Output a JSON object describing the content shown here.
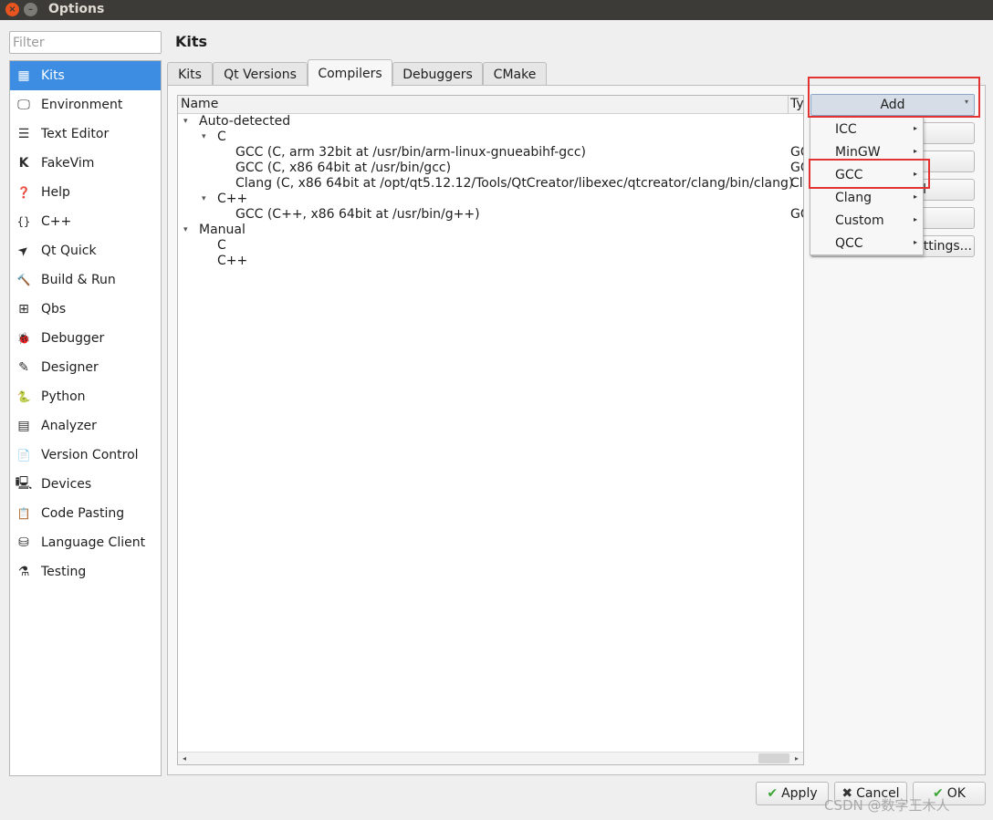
{
  "window": {
    "title": "Options",
    "close_glyph": "×",
    "min_glyph": "–"
  },
  "filter": {
    "placeholder": "Filter",
    "value": ""
  },
  "sidebar": {
    "items": [
      {
        "label": "Kits",
        "icon": "kits-icon",
        "glyph": "▦"
      },
      {
        "label": "Environment",
        "icon": "monitor-icon",
        "glyph": "🖵"
      },
      {
        "label": "Text Editor",
        "icon": "text-editor-icon",
        "glyph": "☰"
      },
      {
        "label": "FakeVim",
        "icon": "fakevim-icon",
        "glyph": "K"
      },
      {
        "label": "Help",
        "icon": "help-icon",
        "glyph": "❓"
      },
      {
        "label": "C++",
        "icon": "braces-icon",
        "glyph": "{}"
      },
      {
        "label": "Qt Quick",
        "icon": "qt-quick-icon",
        "glyph": "➤"
      },
      {
        "label": "Build & Run",
        "icon": "hammer-icon",
        "glyph": "🔨"
      },
      {
        "label": "Qbs",
        "icon": "qbs-icon",
        "glyph": "⊞"
      },
      {
        "label": "Debugger",
        "icon": "bug-icon",
        "glyph": "🐞"
      },
      {
        "label": "Designer",
        "icon": "pencil-icon",
        "glyph": "✎"
      },
      {
        "label": "Python",
        "icon": "python-icon",
        "glyph": "🐍"
      },
      {
        "label": "Analyzer",
        "icon": "analyzer-icon",
        "glyph": "▤"
      },
      {
        "label": "Version Control",
        "icon": "version-control-icon",
        "glyph": "📄"
      },
      {
        "label": "Devices",
        "icon": "devices-icon",
        "glyph": "🖳"
      },
      {
        "label": "Code Pasting",
        "icon": "code-pasting-icon",
        "glyph": "📋"
      },
      {
        "label": "Language Client",
        "icon": "language-client-icon",
        "glyph": "⛁"
      },
      {
        "label": "Testing",
        "icon": "testing-icon",
        "glyph": "⚗"
      }
    ]
  },
  "page_title": "Kits",
  "tabs": [
    "Kits",
    "Qt Versions",
    "Compilers",
    "Debuggers",
    "CMake"
  ],
  "tree": {
    "headers": {
      "name": "Name",
      "type": "Ty"
    },
    "rows": [
      {
        "name": "Auto-detected",
        "type": ""
      },
      {
        "name": "C",
        "type": ""
      },
      {
        "name": "GCC (C, arm 32bit at /usr/bin/arm-linux-gnueabihf-gcc)",
        "type": "GC"
      },
      {
        "name": "GCC (C, x86 64bit at /usr/bin/gcc)",
        "type": "GC"
      },
      {
        "name": "Clang (C, x86 64bit at /opt/qt5.12.12/Tools/QtCreator/libexec/qtcreator/clang/bin/clang)",
        "type": "Cl"
      },
      {
        "name": "C++",
        "type": ""
      },
      {
        "name": "GCC (C++, x86 64bit at /usr/bin/g++)",
        "type": "GC"
      },
      {
        "name": "Manual",
        "type": ""
      },
      {
        "name": "C",
        "type": ""
      },
      {
        "name": "C++",
        "type": ""
      }
    ],
    "expand_glyph": "▾",
    "scroll_left": "◂",
    "scroll_right": "▸"
  },
  "buttons": {
    "add": "Add",
    "add_arrow": "▾",
    "clone_partial": "",
    "remove_partial": "",
    "third_partial": "l",
    "fourth_partial": "",
    "settings_partial": "ttings..."
  },
  "menu": {
    "items": [
      "ICC",
      "MinGW",
      "GCC",
      "Clang",
      "Custom",
      "QCC"
    ],
    "arrow": "▸"
  },
  "footer": {
    "apply": "Apply",
    "cancel": "Cancel",
    "ok": "OK",
    "apply_icon": "✔",
    "cancel_icon": "✖",
    "ok_icon": "✔"
  },
  "colors": {
    "selection": "#3d8ee2",
    "highlight_box": "#e33232",
    "apply_icon": "#3aa634",
    "ok_icon": "#3aa634",
    "cancel_icon": "#333333"
  },
  "watermark": "CSDN @数字王木人"
}
